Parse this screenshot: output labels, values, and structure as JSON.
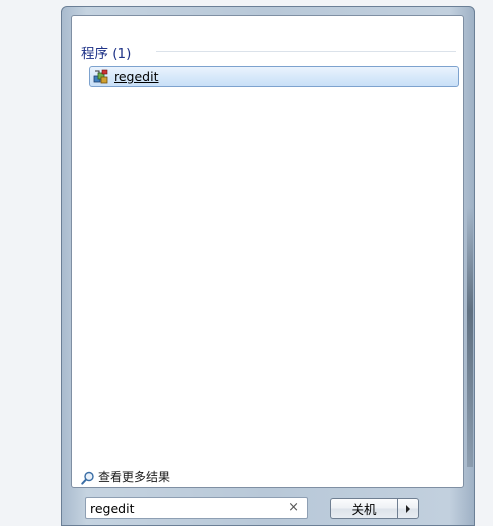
{
  "results": {
    "section_title": "程序 (1)",
    "items": [
      {
        "label": "regedit",
        "icon": "regedit-icon"
      }
    ]
  },
  "see_more": {
    "label": "查看更多结果",
    "icon": "search-icon"
  },
  "search": {
    "value": "regedit",
    "clear_icon": "×"
  },
  "shutdown": {
    "label": "关机",
    "arrow_icon": "▸"
  },
  "colors": {
    "section_title": "#1e3287",
    "selection_border": "#7da2ce",
    "selection_fill": "#d8e9fa"
  }
}
